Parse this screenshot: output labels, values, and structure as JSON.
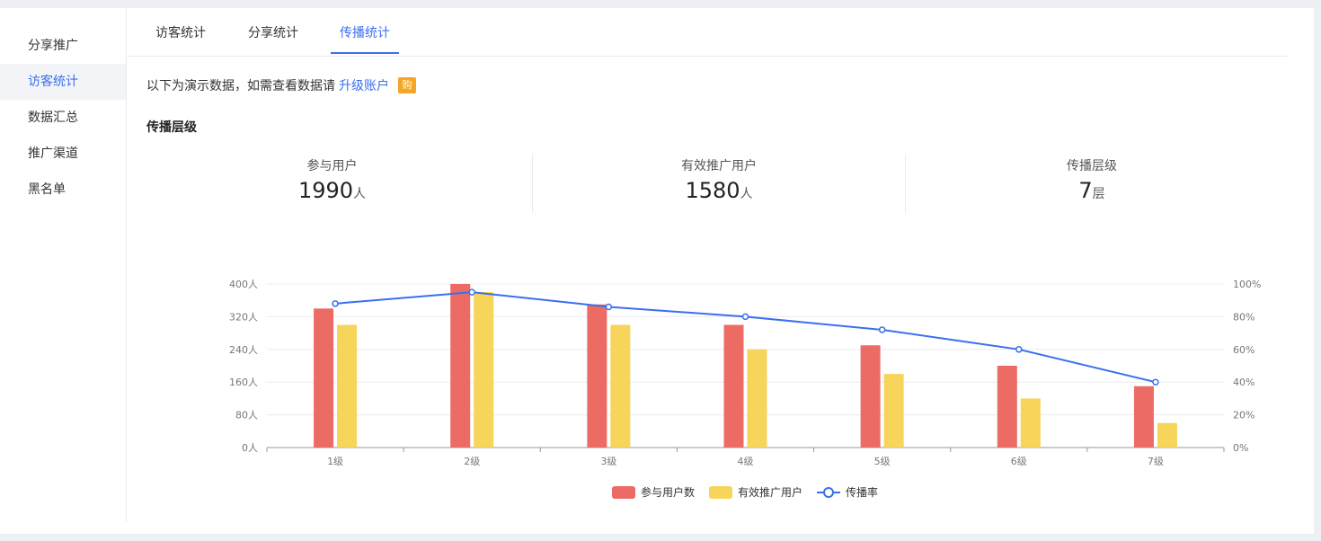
{
  "sidebar": {
    "items": [
      {
        "label": "分享推广"
      },
      {
        "label": "访客统计"
      },
      {
        "label": "数据汇总"
      },
      {
        "label": "推广渠道"
      },
      {
        "label": "黑名单"
      }
    ]
  },
  "tabs": [
    {
      "label": "访客统计"
    },
    {
      "label": "分享统计"
    },
    {
      "label": "传播统计"
    }
  ],
  "notice": {
    "text": "以下为演示数据，如需查看数据请",
    "link": "升级账户",
    "badge": "购"
  },
  "section": {
    "title": "传播层级"
  },
  "stats": [
    {
      "label": "参与用户",
      "value": "1990",
      "unit": "人"
    },
    {
      "label": "有效推广用户",
      "value": "1580",
      "unit": "人"
    },
    {
      "label": "传播层级",
      "value": "7",
      "unit": "层"
    }
  ],
  "colors": {
    "accent": "#3a6ff0",
    "bar1": "#ec6b64",
    "bar2": "#f7d45a",
    "line": "#3a6ff0",
    "badge": "#f5a623"
  },
  "chart_data": {
    "type": "bar",
    "categories": [
      "1级",
      "2级",
      "3级",
      "4级",
      "5级",
      "6级",
      "7级"
    ],
    "series": [
      {
        "name": "参与用户数",
        "type": "bar",
        "axis": "left",
        "values": [
          340,
          400,
          350,
          300,
          250,
          200,
          150
        ]
      },
      {
        "name": "有效推广用户",
        "type": "bar",
        "axis": "left",
        "values": [
          300,
          380,
          300,
          240,
          180,
          120,
          60
        ]
      },
      {
        "name": "传播率",
        "type": "line",
        "axis": "right",
        "values": [
          88,
          95,
          86,
          80,
          72,
          60,
          40
        ]
      }
    ],
    "y_left": {
      "ticks": [
        "0人",
        "80人",
        "160人",
        "240人",
        "320人",
        "400人"
      ],
      "ylim": [
        0,
        400
      ]
    },
    "y_right": {
      "ticks": [
        "0%",
        "20%",
        "40%",
        "60%",
        "80%",
        "100%"
      ],
      "ylim": [
        0,
        100
      ]
    },
    "grid": true,
    "legend_position": "bottom-center"
  }
}
